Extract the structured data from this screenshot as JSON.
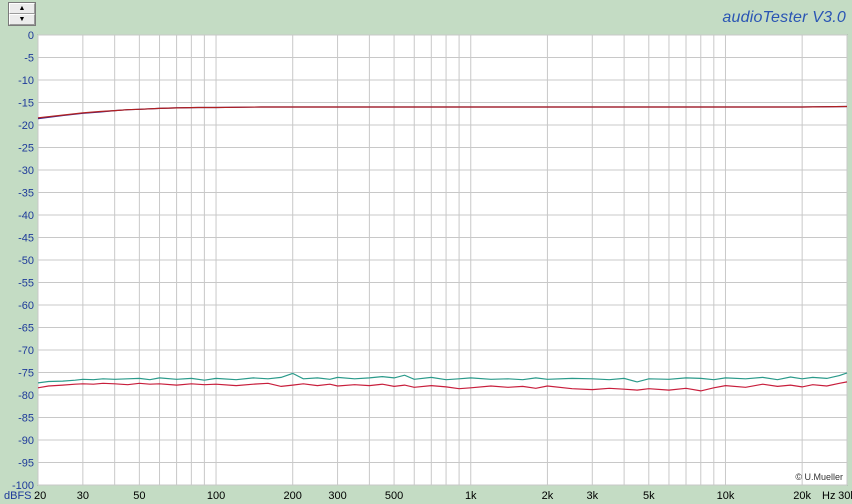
{
  "app": {
    "brand": "audioTester  V3.0",
    "spin_up_glyph": "▲",
    "spin_down_glyph": "▼",
    "copyright": "© U.Mueller"
  },
  "colors": {
    "background": "#c4dcc4",
    "plot_background": "#ffffff",
    "grid": "#c8c8c8",
    "axis_label": "#1e3a9a",
    "brand": "#2a55b4"
  },
  "chart_data": {
    "type": "line",
    "title": "",
    "xlabel": "",
    "ylabel": "",
    "x_unit": "Hz",
    "y_unit": "dBFS",
    "x_scale": "log",
    "xlim": [
      20,
      30000
    ],
    "ylim": [
      -100,
      0
    ],
    "y_ticks": [
      0,
      -5,
      -10,
      -15,
      -20,
      -25,
      -30,
      -35,
      -40,
      -45,
      -50,
      -55,
      -60,
      -65,
      -70,
      -75,
      -80,
      -85,
      -90,
      -95,
      -100
    ],
    "x_ticks": [
      {
        "value": 20,
        "label": "20"
      },
      {
        "value": 30,
        "label": "30"
      },
      {
        "value": 50,
        "label": "50"
      },
      {
        "value": 100,
        "label": "100"
      },
      {
        "value": 200,
        "label": "200"
      },
      {
        "value": 300,
        "label": "300"
      },
      {
        "value": 500,
        "label": "500"
      },
      {
        "value": 1000,
        "label": "1k"
      },
      {
        "value": 2000,
        "label": "2k"
      },
      {
        "value": 3000,
        "label": "3k"
      },
      {
        "value": 5000,
        "label": "5k"
      },
      {
        "value": 10000,
        "label": "10k"
      },
      {
        "value": 20000,
        "label": "20k"
      },
      {
        "value": 30000,
        "label": "30k"
      }
    ],
    "grid": true,
    "legend": "none",
    "series": [
      {
        "color": "#3a1f8a",
        "x": [
          20,
          25,
          30,
          35,
          40,
          45,
          50,
          60,
          70,
          85,
          100,
          150,
          200,
          300,
          500,
          1000,
          2000,
          5000,
          10000,
          20000,
          30000
        ],
        "y": [
          -18.6,
          -17.9,
          -17.4,
          -17.1,
          -16.8,
          -16.6,
          -16.5,
          -16.3,
          -16.2,
          -16.1,
          -16.1,
          -16.0,
          -16.0,
          -16.0,
          -16.0,
          -16.0,
          -16.0,
          -16.0,
          -16.0,
          -16.0,
          -15.9
        ]
      },
      {
        "color": "#b02020",
        "x": [
          20,
          25,
          30,
          35,
          40,
          45,
          50,
          60,
          70,
          85,
          100,
          150,
          200,
          300,
          500,
          1000,
          2000,
          5000,
          10000,
          20000,
          30000
        ],
        "y": [
          -18.4,
          -17.8,
          -17.3,
          -17.0,
          -16.8,
          -16.6,
          -16.5,
          -16.3,
          -16.2,
          -16.1,
          -16.1,
          -16.0,
          -16.0,
          -16.0,
          -16.0,
          -16.0,
          -16.0,
          -16.0,
          -16.0,
          -16.0,
          -15.9
        ]
      },
      {
        "color": "#2a9a8a",
        "x": [
          20,
          22,
          25,
          28,
          30,
          33,
          36,
          40,
          45,
          50,
          55,
          60,
          70,
          80,
          90,
          100,
          120,
          140,
          160,
          180,
          200,
          220,
          250,
          280,
          300,
          350,
          400,
          450,
          500,
          550,
          600,
          700,
          800,
          900,
          1000,
          1200,
          1400,
          1600,
          1800,
          2000,
          2500,
          3000,
          3500,
          4000,
          4500,
          5000,
          6000,
          7000,
          8000,
          9000,
          10000,
          12000,
          14000,
          16000,
          18000,
          20000,
          22000,
          25000,
          28000,
          30000
        ],
        "y": [
          -77.3,
          -77.0,
          -76.9,
          -76.7,
          -76.5,
          -76.6,
          -76.4,
          -76.5,
          -76.4,
          -76.3,
          -76.6,
          -76.2,
          -76.5,
          -76.3,
          -76.7,
          -76.3,
          -76.6,
          -76.2,
          -76.4,
          -76.1,
          -75.2,
          -76.4,
          -76.2,
          -76.5,
          -76.1,
          -76.4,
          -76.2,
          -75.9,
          -76.2,
          -75.6,
          -76.5,
          -76.1,
          -76.6,
          -76.4,
          -76.2,
          -76.5,
          -76.4,
          -76.6,
          -76.2,
          -76.5,
          -76.3,
          -76.4,
          -76.6,
          -76.3,
          -77.1,
          -76.4,
          -76.5,
          -76.2,
          -76.3,
          -76.6,
          -76.2,
          -76.4,
          -76.1,
          -76.6,
          -76.0,
          -76.4,
          -76.1,
          -76.3,
          -75.7,
          -75.1
        ]
      },
      {
        "color": "#c81e3c",
        "x": [
          20,
          22,
          25,
          28,
          30,
          33,
          36,
          40,
          45,
          50,
          55,
          60,
          70,
          80,
          90,
          100,
          120,
          140,
          160,
          180,
          200,
          220,
          250,
          280,
          300,
          350,
          400,
          450,
          500,
          550,
          600,
          700,
          800,
          900,
          1000,
          1200,
          1400,
          1600,
          1800,
          2000,
          2500,
          3000,
          3500,
          4000,
          4500,
          5000,
          6000,
          7000,
          8000,
          9000,
          10000,
          12000,
          14000,
          16000,
          18000,
          20000,
          22000,
          25000,
          28000,
          30000
        ],
        "y": [
          -78.4,
          -78.0,
          -77.8,
          -77.6,
          -77.5,
          -77.6,
          -77.4,
          -77.5,
          -77.7,
          -77.4,
          -77.6,
          -77.5,
          -77.8,
          -77.5,
          -77.7,
          -77.6,
          -77.9,
          -77.6,
          -77.4,
          -78.1,
          -77.8,
          -77.5,
          -77.9,
          -77.6,
          -78.0,
          -77.7,
          -77.9,
          -77.6,
          -78.1,
          -77.8,
          -78.3,
          -77.9,
          -78.2,
          -78.6,
          -78.4,
          -78.0,
          -78.3,
          -78.1,
          -78.5,
          -78.0,
          -78.6,
          -78.8,
          -78.5,
          -78.7,
          -78.9,
          -78.6,
          -78.9,
          -78.5,
          -79.1,
          -78.4,
          -77.9,
          -78.3,
          -77.6,
          -78.1,
          -77.8,
          -78.2,
          -77.7,
          -78.0,
          -77.4,
          -77.1
        ]
      }
    ]
  }
}
